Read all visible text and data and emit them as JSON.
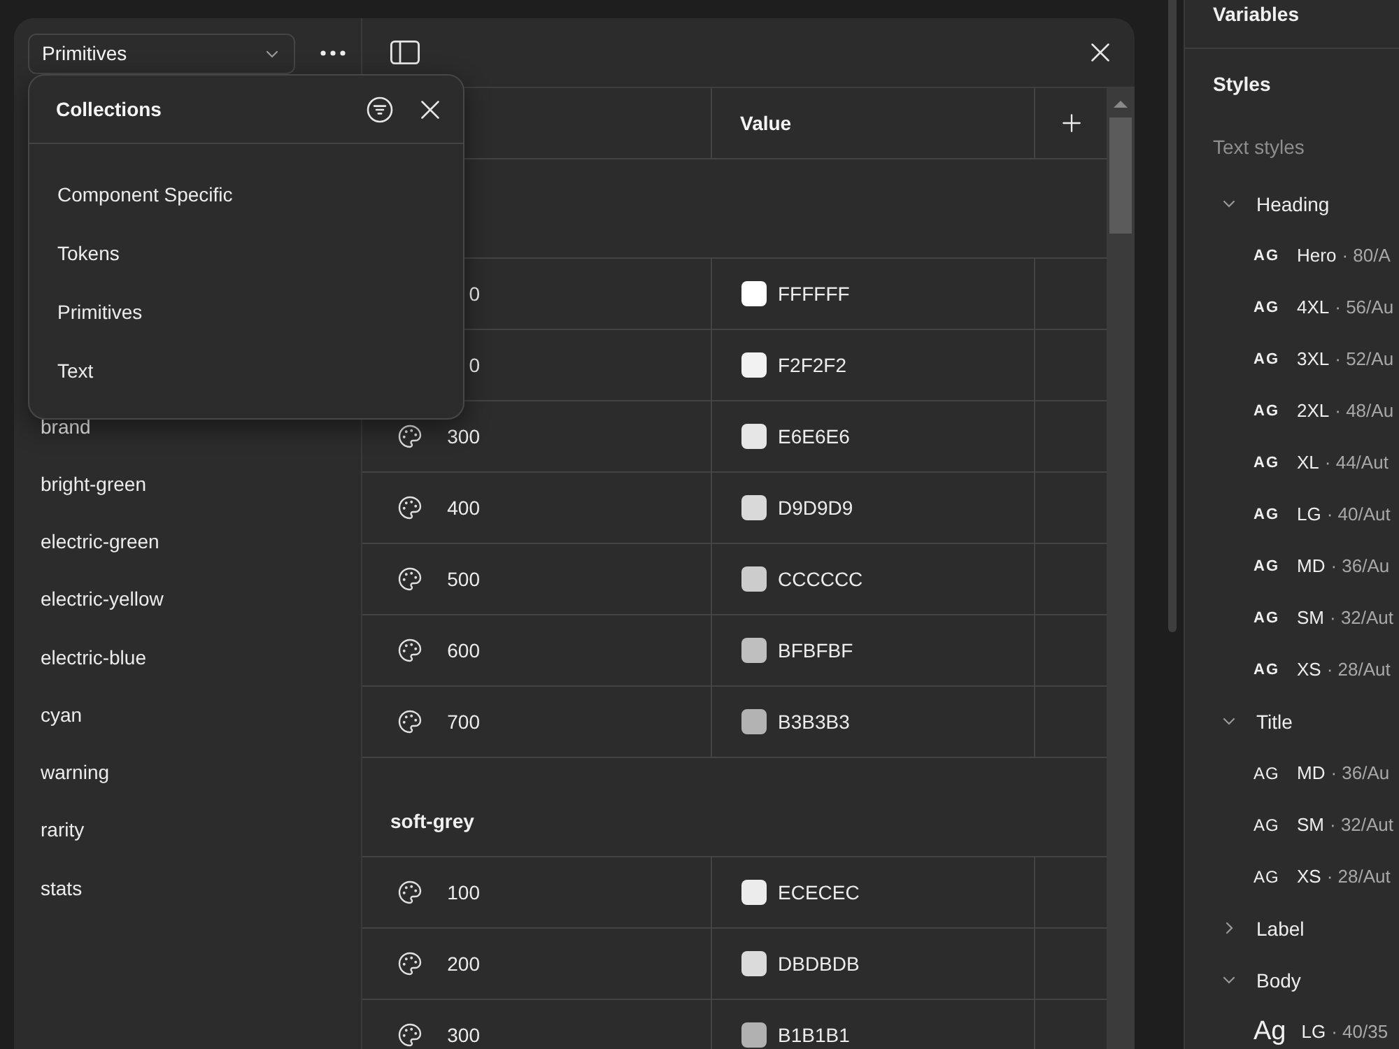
{
  "collection_picker": {
    "value": "Primitives"
  },
  "collections_menu": {
    "title": "Collections",
    "items": [
      {
        "label": "Component Specific",
        "selected": false
      },
      {
        "label": "Tokens",
        "selected": false
      },
      {
        "label": "Primitives",
        "selected": false
      },
      {
        "label": "Text",
        "selected": false
      }
    ]
  },
  "sidebar": {
    "items": [
      {
        "label": "brand"
      },
      {
        "label": "bright-green"
      },
      {
        "label": "electric-green"
      },
      {
        "label": "electric-yellow"
      },
      {
        "label": "electric-blue"
      },
      {
        "label": "cyan"
      },
      {
        "label": "warning"
      },
      {
        "label": "rarity"
      },
      {
        "label": "stats"
      }
    ]
  },
  "table": {
    "value_header": "Value",
    "groups": [
      {
        "rows": [
          {
            "kind": "clipped",
            "name": "0",
            "value": "FFFFFF",
            "color": "#ffffff"
          },
          {
            "kind": "clipped",
            "name": "0",
            "value": "F2F2F2",
            "color": "#f2f2f2"
          },
          {
            "kind": "variable",
            "name": "300",
            "value": "E6E6E6",
            "color": "#e6e6e6"
          },
          {
            "kind": "variable",
            "name": "400",
            "value": "D9D9D9",
            "color": "#d9d9d9"
          },
          {
            "kind": "variable",
            "name": "500",
            "value": "CCCCCC",
            "color": "#cccccc"
          },
          {
            "kind": "variable",
            "name": "600",
            "value": "BFBFBF",
            "color": "#bfbfbf"
          },
          {
            "kind": "variable",
            "name": "700",
            "value": "B3B3B3",
            "color": "#b3b3b3"
          }
        ]
      },
      {
        "title": "soft-grey",
        "rows": [
          {
            "kind": "variable",
            "name": "100",
            "value": "ECECEC",
            "color": "#ececec"
          },
          {
            "kind": "variable",
            "name": "200",
            "value": "DBDBDB",
            "color": "#dbdbdb"
          },
          {
            "kind": "variable",
            "name": "300",
            "value": "B1B1B1",
            "color": "#b1b1b1"
          }
        ]
      }
    ]
  },
  "right_panel": {
    "variables_title": "Variables",
    "styles_title": "Styles",
    "text_styles_label": "Text styles",
    "groups": [
      {
        "label": "Heading",
        "expanded": true,
        "styles": [
          {
            "kind": "bold",
            "preview": "AG",
            "name": "Hero",
            "detail": "· 80/A"
          },
          {
            "kind": "bold",
            "preview": "AG",
            "name": "4XL",
            "detail": "· 56/Au"
          },
          {
            "kind": "bold",
            "preview": "AG",
            "name": "3XL",
            "detail": "· 52/Au"
          },
          {
            "kind": "bold",
            "preview": "AG",
            "name": "2XL",
            "detail": "· 48/Au"
          },
          {
            "kind": "bold",
            "preview": "AG",
            "name": "XL",
            "detail": "· 44/Aut"
          },
          {
            "kind": "bold",
            "preview": "AG",
            "name": "LG",
            "detail": "· 40/Aut"
          },
          {
            "kind": "bold",
            "preview": "AG",
            "name": "MD",
            "detail": "· 36/Au"
          },
          {
            "kind": "bold",
            "preview": "AG",
            "name": "SM",
            "detail": "· 32/Aut"
          },
          {
            "kind": "bold",
            "preview": "AG",
            "name": "XS",
            "detail": "· 28/Aut"
          }
        ]
      },
      {
        "label": "Title",
        "expanded": true,
        "styles": [
          {
            "kind": "regular",
            "preview": "AG",
            "name": "MD",
            "detail": "· 36/Au"
          },
          {
            "kind": "regular",
            "preview": "AG",
            "name": "SM",
            "detail": "· 32/Aut"
          },
          {
            "kind": "regular",
            "preview": "AG",
            "name": "XS",
            "detail": "· 28/Aut"
          }
        ]
      },
      {
        "label": "Label",
        "expanded": false
      },
      {
        "label": "Body",
        "expanded": true,
        "styles": [
          {
            "kind": "large",
            "preview": "Ag",
            "name": "LG",
            "detail": "· 40/35"
          }
        ]
      }
    ]
  }
}
